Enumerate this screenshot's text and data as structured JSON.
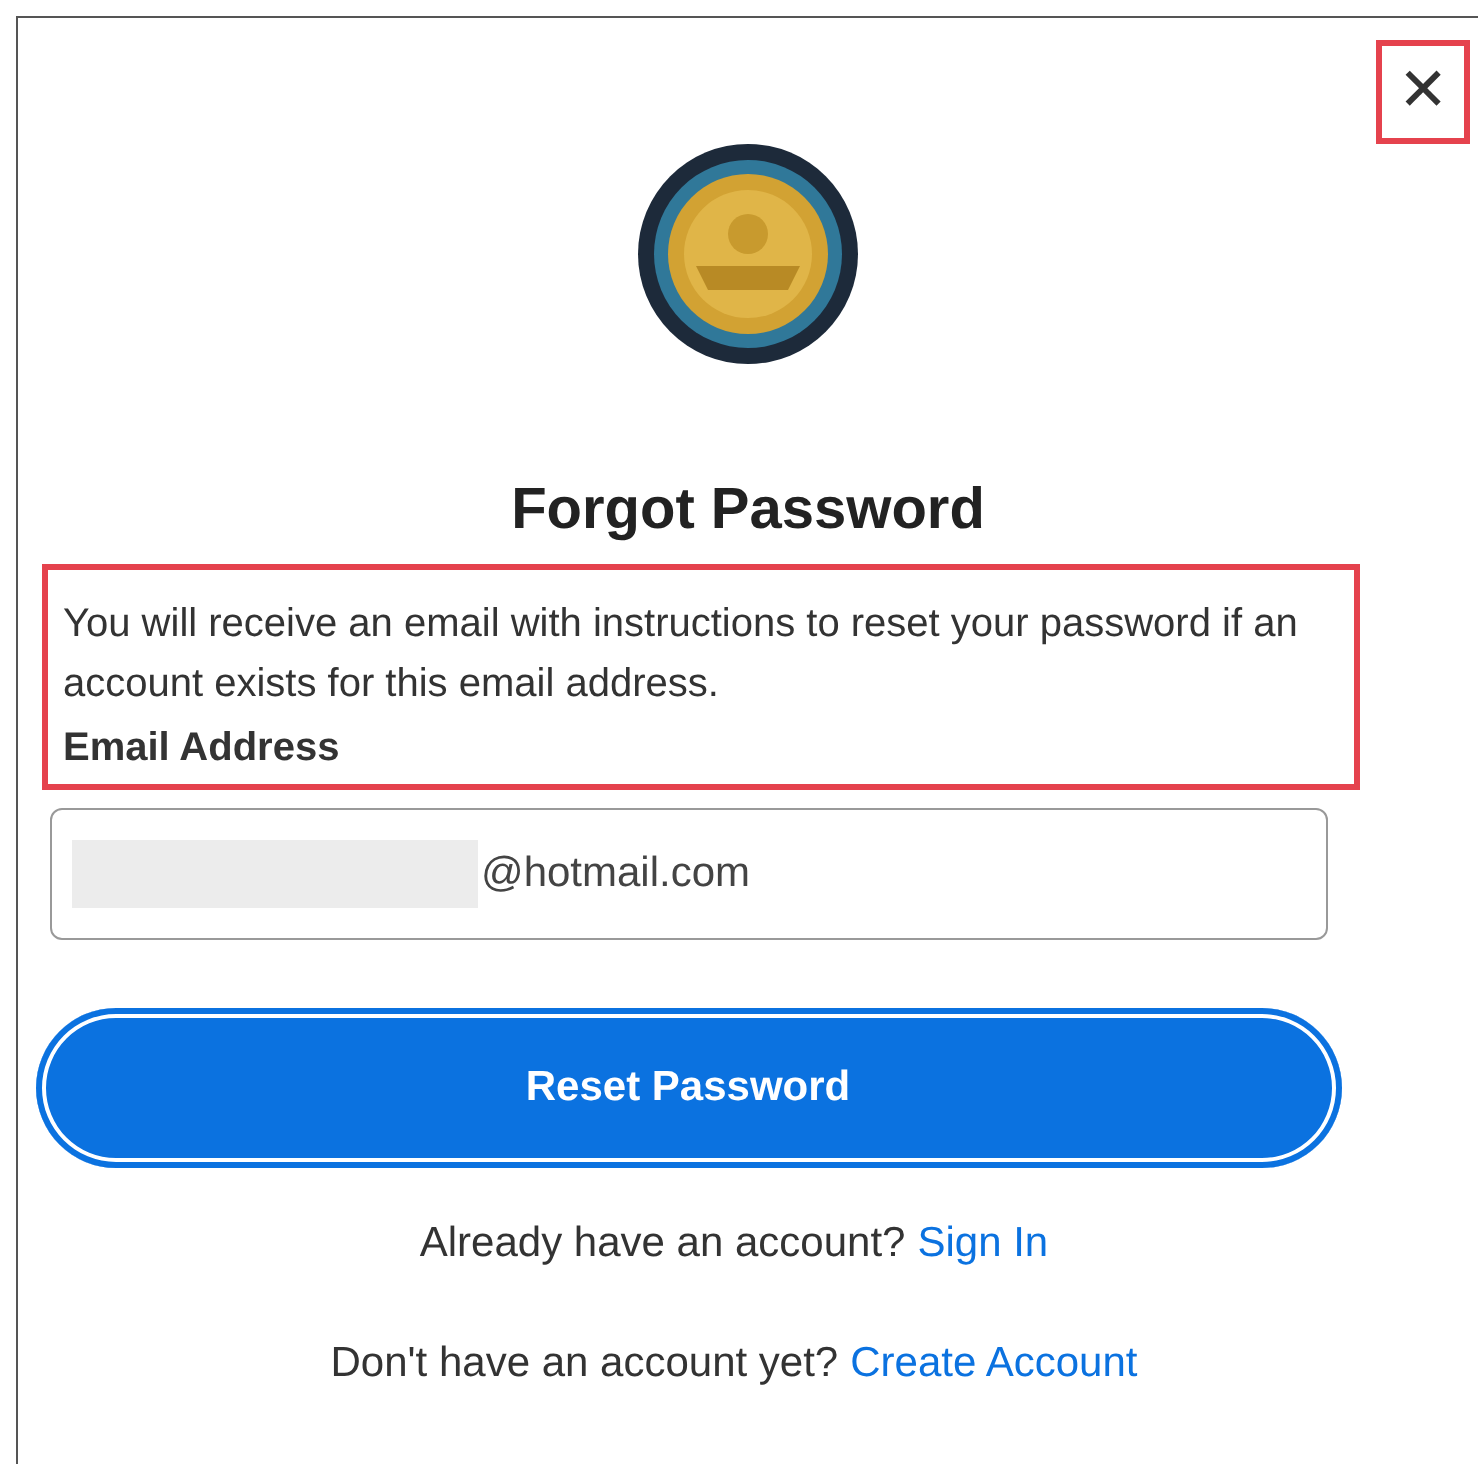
{
  "dialog": {
    "close": "✕",
    "title": "Forgot Password",
    "description": "You will receive an email with instructions to reset your password if an account exists for this email address.",
    "email": {
      "label": "Email Address",
      "value": "@hotmail.com"
    },
    "submit": "Reset Password",
    "links": [
      {
        "prompt": "Already have an account?",
        "link": "Sign In"
      },
      {
        "prompt": "Don't have an account yet?",
        "link": "Create Account"
      }
    ]
  }
}
